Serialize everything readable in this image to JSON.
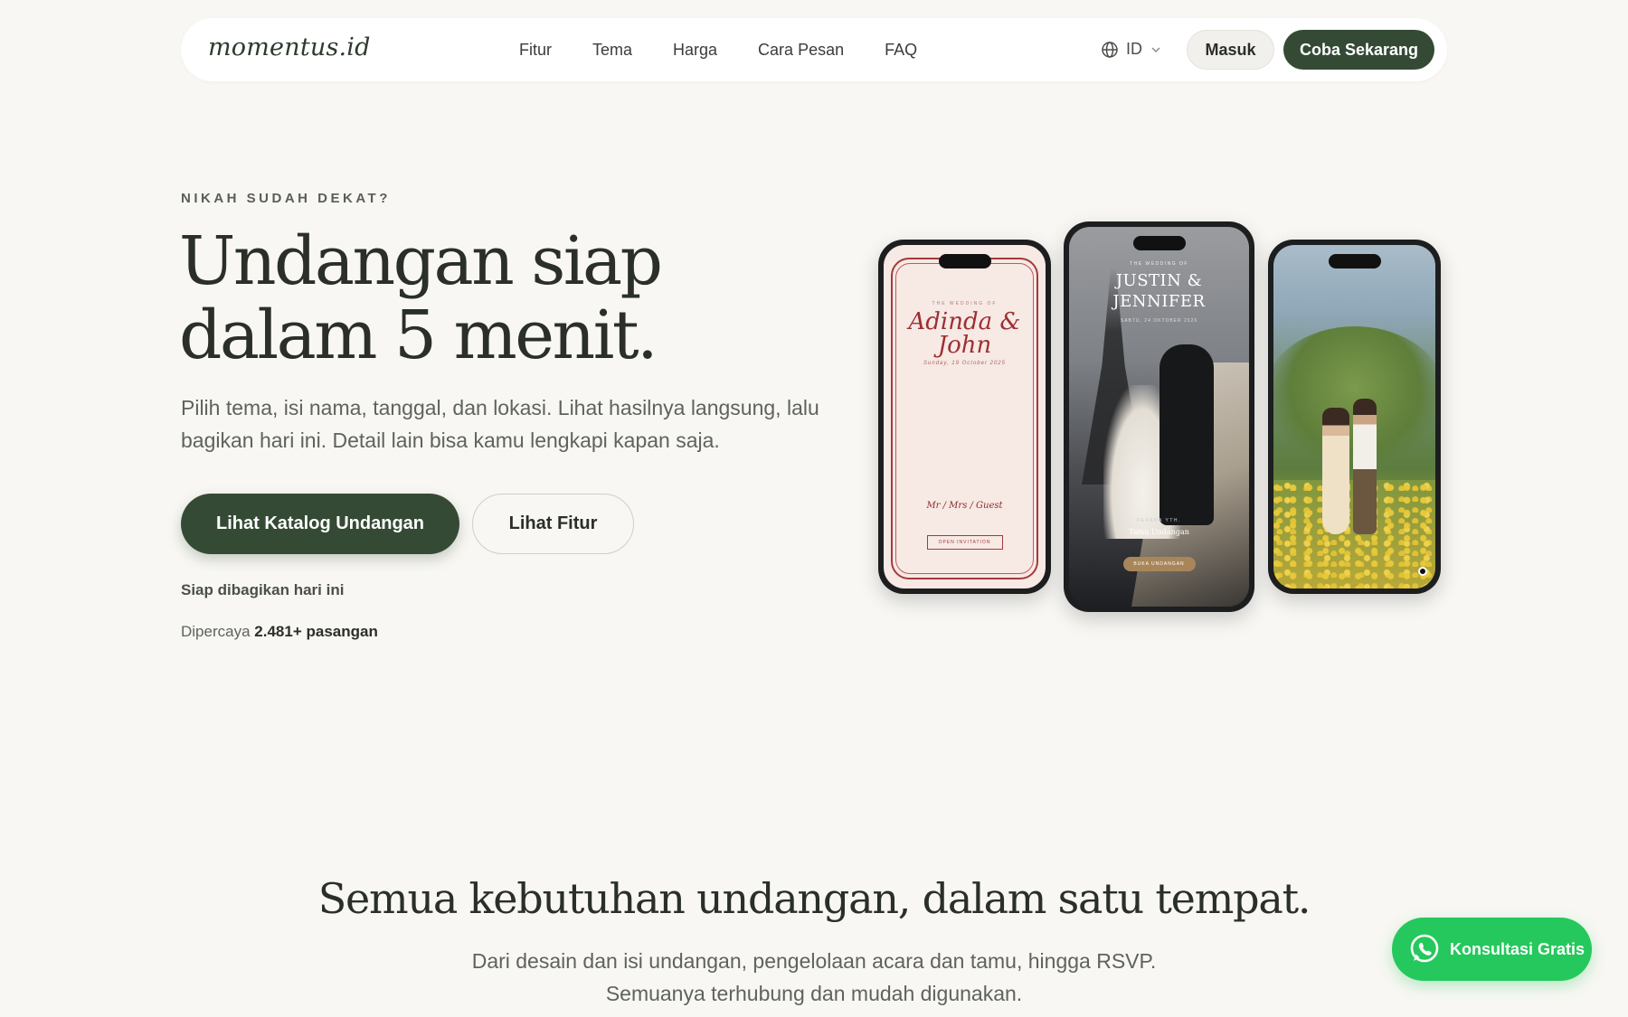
{
  "nav": {
    "logo": "momentus.id",
    "links": [
      "Fitur",
      "Tema",
      "Harga",
      "Cara Pesan",
      "FAQ"
    ],
    "lang": "ID",
    "login": "Masuk",
    "cta": "Coba Sekarang"
  },
  "hero": {
    "eyebrow": "NIKAH SUDAH DEKAT?",
    "title_line1": "Undangan siap",
    "title_line2": "dalam 5 menit.",
    "subtitle": "Pilih tema, isi nama, tanggal, dan lokasi. Lihat hasilnya langsung, lalu bagikan hari ini. Detail lain bisa kamu lengkapi kapan saja.",
    "primary_cta": "Lihat Katalog Undangan",
    "secondary_cta": "Lihat Fitur",
    "ready_note": "Siap dibagikan hari ini",
    "trusted_prefix": "Dipercaya",
    "trusted_count": "2.481+ pasangan"
  },
  "phones": {
    "phone1": {
      "wedding_tag": "THE WEDDING OF",
      "names": "Adinda & John",
      "date": "Sunday, 19 October 2025",
      "guest": "Mr / Mrs / Guest",
      "open_label": "OPEN INVITATION"
    },
    "phone2": {
      "wedding_tag": "THE WEDDING OF",
      "names_line1": "JUSTIN &",
      "names_line2": "JENNIFER",
      "date": "SABTU, 24 OKTOBER 2026",
      "recipient_label": "KEPADA YTH.",
      "guest": "Tamu Undangan",
      "open_label": "BUKA UNDANGAN"
    }
  },
  "features": {
    "title": "Semua kebutuhan undangan, dalam satu tempat.",
    "subtitle_line1": "Dari desain dan isi undangan, pengelolaan acara dan tamu, hingga RSVP.",
    "subtitle_line2": "Semuanya terhubung dan mudah digunakan."
  },
  "whatsapp": {
    "label": "Konsultasi Gratis"
  },
  "colors": {
    "brand": "#344a35",
    "background": "#f8f7f3",
    "whatsapp": "#25c85c"
  }
}
